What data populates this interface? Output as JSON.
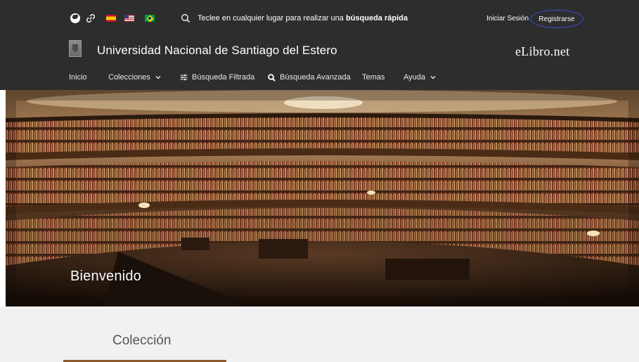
{
  "topbar": {
    "search_prompt": "Teclee en cualquier lugar para realizar una",
    "search_emphasis": "búsqueda rápida",
    "login_label": "Iniciar Sesión",
    "register_label": "Registrarse",
    "language_flags": [
      "es",
      "us",
      "br"
    ],
    "icons": [
      "globe-icon",
      "link-icon",
      "search-icon"
    ]
  },
  "header": {
    "institution": "Universidad Nacional de Santiago del Estero",
    "brand": "eLibro.net"
  },
  "nav": {
    "items": [
      {
        "label": "Inicio"
      },
      {
        "label": "Colecciones",
        "dropdown": true
      },
      {
        "label": "Búsqueda Filtrada",
        "icon": "sliders-icon"
      },
      {
        "label": "Búsqueda Avanzada",
        "icon": "search-icon"
      },
      {
        "label": "Temas"
      },
      {
        "label": "Ayuda",
        "dropdown": true
      }
    ]
  },
  "hero": {
    "welcome": "Bienvenido"
  },
  "section": {
    "title": "Colección"
  },
  "colors": {
    "header_bg": "#2d2d2e",
    "register_circle": "#3b4fd8",
    "section_bg": "#f1f1f1",
    "accent_brown": "#8b5a2b"
  }
}
